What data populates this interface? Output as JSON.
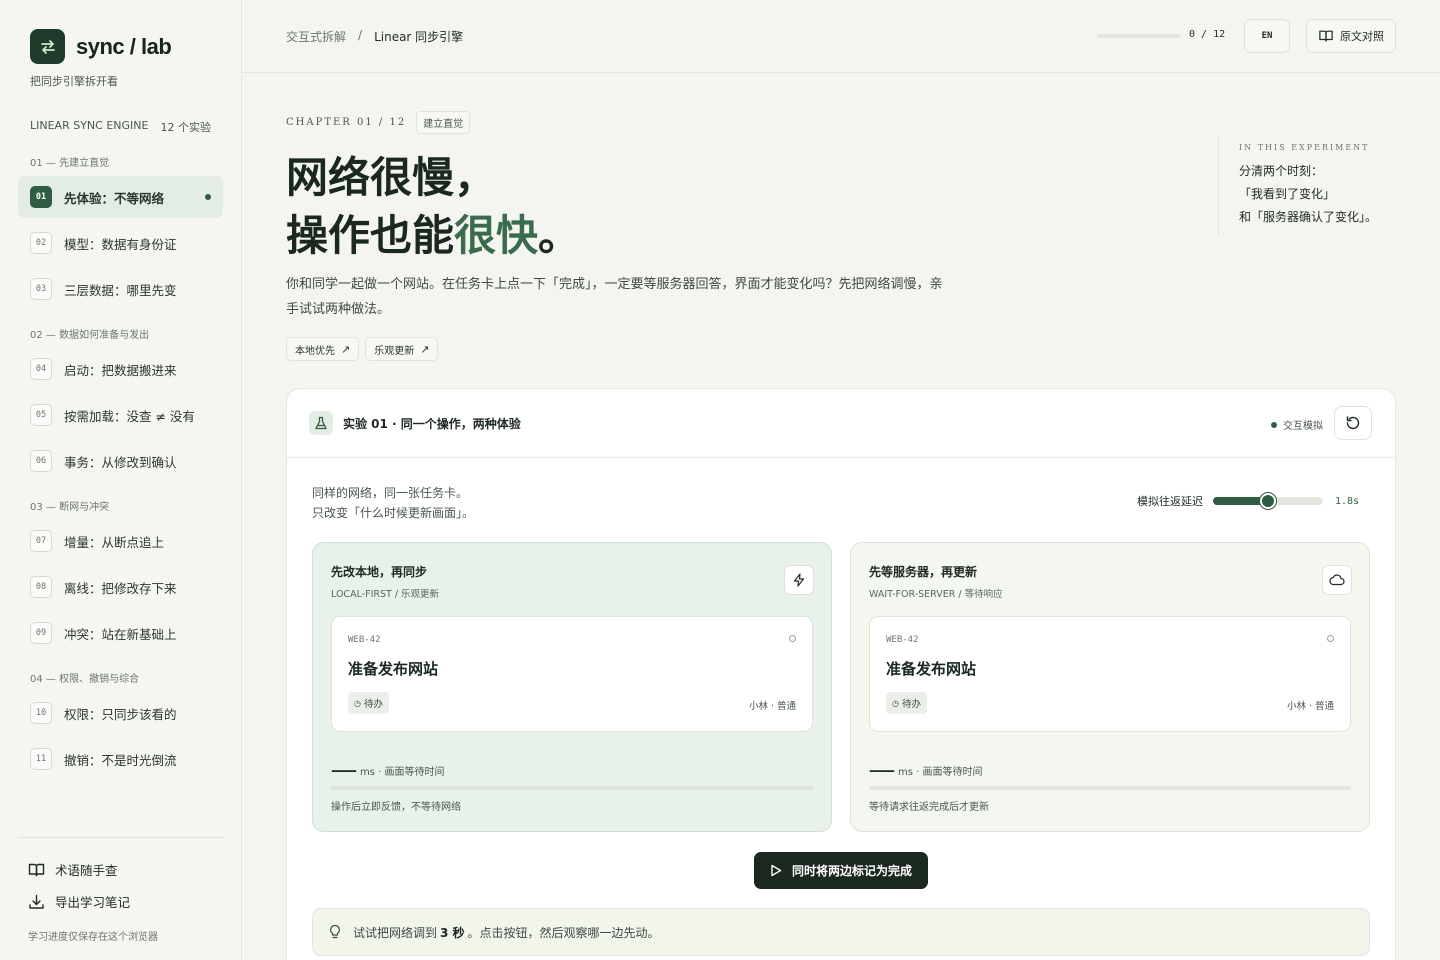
{
  "brand": {
    "name": "sync / lab",
    "tagline": "把同步引擎拆开看"
  },
  "sidebar": {
    "engine": "LINEAR SYNC ENGINE",
    "count": "12 个实验",
    "sections": [
      {
        "label": "01 — 先建立直觉",
        "items": [
          {
            "num": "01",
            "label": "先体验：不等网络",
            "active": true
          },
          {
            "num": "02",
            "label": "模型：数据有身份证"
          },
          {
            "num": "03",
            "label": "三层数据：哪里先变"
          }
        ]
      },
      {
        "label": "02 — 数据如何准备与发出",
        "items": [
          {
            "num": "04",
            "label": "启动：把数据搬进来"
          },
          {
            "num": "05",
            "label": "按需加载：没查 ≠ 没有"
          },
          {
            "num": "06",
            "label": "事务：从修改到确认"
          }
        ]
      },
      {
        "label": "03 — 断网与冲突",
        "items": [
          {
            "num": "07",
            "label": "增量：从断点追上"
          },
          {
            "num": "08",
            "label": "离线：把修改存下来"
          },
          {
            "num": "09",
            "label": "冲突：站在新基础上"
          }
        ]
      },
      {
        "label": "04 — 权限、撤销与综合",
        "items": [
          {
            "num": "10",
            "label": "权限：只同步该看的"
          },
          {
            "num": "11",
            "label": "撤销：不是时光倒流"
          }
        ]
      }
    ],
    "glossary": "术语随手查",
    "export": "导出学习笔记",
    "footnote": "学习进度仅保存在这个浏览器"
  },
  "topbar": {
    "crumb_root": "交互式拆解",
    "crumb_sep": "/",
    "crumb_current": "Linear 同步引擎",
    "progress_text": "0 / 12",
    "progress_value": 0,
    "lang": "EN",
    "original": "原文对照"
  },
  "hero": {
    "chapter": "CHAPTER 01 / 12",
    "chip": "建立直觉",
    "line1": "网络很慢，",
    "line2_pre": "操作也能",
    "line2_accent": "很快",
    "line2_post": "。",
    "intro": "你和同学一起做一个网站。在任务卡上点一下「完成」，一定要等服务器回答，界面才能变化吗？先把网络调慢，亲手试试两种做法。",
    "tags": [
      "本地优先",
      "乐观更新"
    ],
    "aside_label": "IN THIS EXPERIMENT",
    "aside_lines": [
      "分清两个时刻：",
      "「我看到了变化」",
      "和「服务器确认了变化」。"
    ]
  },
  "experiment": {
    "title": "实验 01 · 同一个操作，两种体验",
    "badge": "交互模拟",
    "desc_1": "同样的网络，同一张任务卡。",
    "desc_2": "只改变「什么时候更新画面」。",
    "latency_label": "模拟往返延迟",
    "latency_value": "1.8s",
    "latency_fraction": 0.5,
    "left": {
      "title": "先改本地，再同步",
      "sub": "LOCAL-FIRST / 乐观更新",
      "task_id": "WEB-42",
      "task_title": "准备发布网站",
      "status": "待办",
      "meta": "小林 · 普通",
      "wait_value": "——",
      "wait_label": "ms · 画面等待时间",
      "foot": "操作后立即反馈，不等待网络"
    },
    "right": {
      "title": "先等服务器，再更新",
      "sub": "WAIT-FOR-SERVER / 等待响应",
      "task_id": "WEB-42",
      "task_title": "准备发布网站",
      "status": "待办",
      "meta": "小林 · 普通",
      "wait_value": "——",
      "wait_label": "ms · 画面等待时间",
      "foot": "等待请求往返完成后才更新"
    },
    "run_label": "同时将两边标记为完成",
    "hint_pre": "试试把网络调到",
    "hint_bold": "3 秒",
    "hint_post": "。点击按钮，然后观察哪一边先动。"
  },
  "colors": {
    "accent": "#2f5c42",
    "brand_bg": "#1f3b2c",
    "local_bg": "#e8f1ea"
  }
}
